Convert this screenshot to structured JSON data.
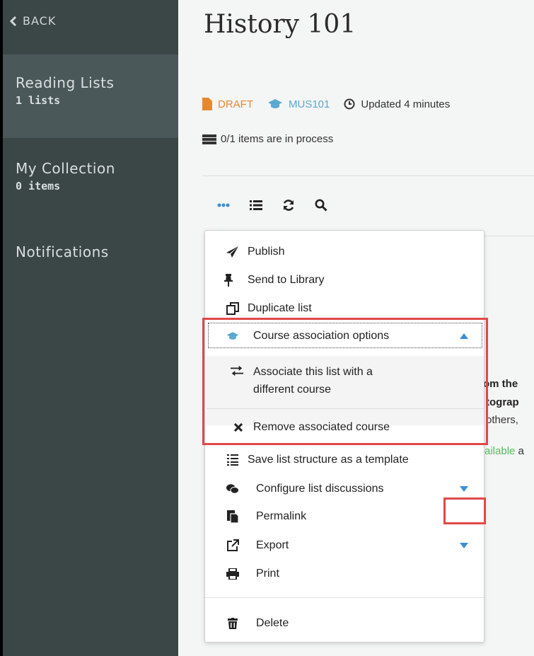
{
  "sidebar": {
    "back_label": "BACK",
    "items": [
      {
        "title": "Reading Lists",
        "sub": "1 lists"
      },
      {
        "title": "My Collection",
        "sub": "0 items"
      },
      {
        "title": "Notifications",
        "sub": ""
      }
    ]
  },
  "main": {
    "title": "History 101",
    "status": "DRAFT",
    "course": "MUS101",
    "updated": "Updated 4 minutes",
    "process": "0/1 items are in process",
    "bg_text": {
      "line1": "om the",
      "line2": "tograp",
      "line3": "others,",
      "line4": "ailable",
      "line4_tail": "a"
    }
  },
  "toolbar": {
    "icons": [
      "more-icon",
      "list-icon",
      "refresh-icon",
      "search-icon"
    ]
  },
  "menu": {
    "publish": "Publish",
    "send_to_library": "Send to Library",
    "duplicate": "Duplicate list",
    "course_options": "Course association options",
    "associate": "Associate this list with a different course",
    "associate_line1": "Associate this list with a",
    "associate_line2": "different course",
    "remove_course": "Remove associated course",
    "save_template": "Save list structure as a template",
    "configure_discussions": "Configure list discussions",
    "permalink": "Permalink",
    "export": "Export",
    "print": "Print",
    "delete": "Delete"
  },
  "colors": {
    "sidebar_bg": "#3b4647",
    "sidebar_active": "#4b5859",
    "accent_blue": "#3a8fd6",
    "draft_orange": "#e6892e",
    "highlight_red": "#e04848"
  }
}
